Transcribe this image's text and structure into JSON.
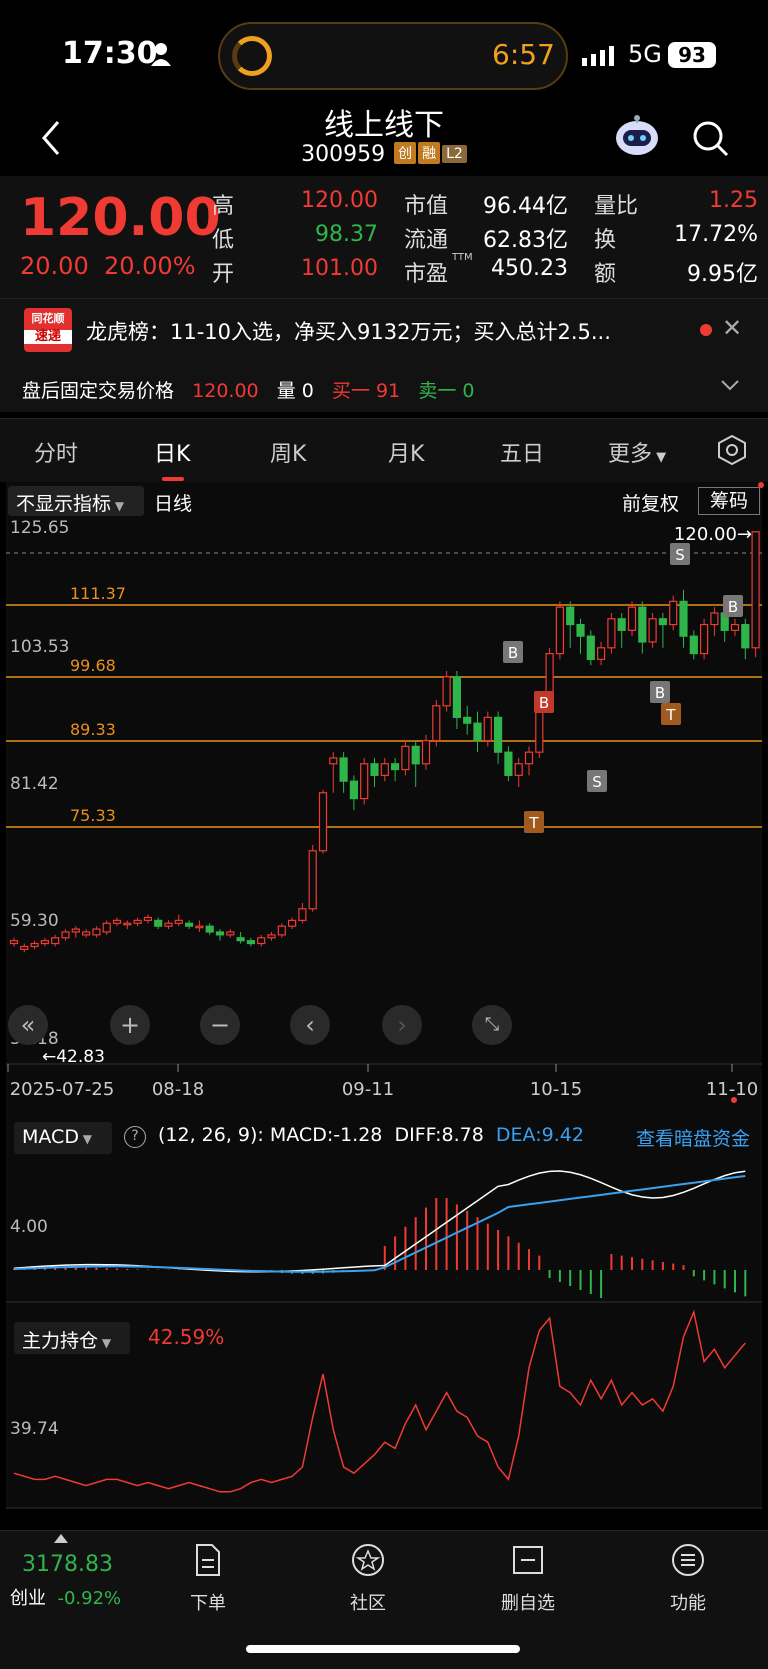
{
  "status_bar": {
    "time": "17:30",
    "island_time": "6:57",
    "network": "5G",
    "battery": "93"
  },
  "header": {
    "title": "线上线下",
    "code": "300959",
    "tags": [
      "创",
      "融",
      "L2"
    ]
  },
  "quote": {
    "price": "120.00",
    "change": "20.00",
    "change_pct": "20.00%",
    "high_label": "高",
    "high": "120.00",
    "low_label": "低",
    "low": "98.37",
    "open_label": "开",
    "open": "101.00",
    "mcap_label": "市值",
    "mcap": "96.44亿",
    "float_label": "流通",
    "float_cap": "62.83亿",
    "pe_label": "市盈",
    "pe_sup": "TTM",
    "pe": "450.23",
    "vol_ratio_label": "量比",
    "vol_ratio": "1.25",
    "turnover_label": "换",
    "turnover": "17.72%",
    "amount_label": "额",
    "amount": "9.95亿"
  },
  "news": {
    "logo_top": "同花顺",
    "logo_bottom": "速递",
    "text": "龙虎榜：11-10入选，净买入9132万元；买入总计2.5..."
  },
  "after_hours": {
    "label": "盘后固定交易价格",
    "price": "120.00",
    "volume": "量 0",
    "buy1": "买一 91",
    "sell1": "卖一 0"
  },
  "tabs": [
    "分时",
    "日K",
    "周K",
    "月K",
    "五日",
    "更多"
  ],
  "active_tab": "日K",
  "kline": {
    "indicator_select": "不显示指标",
    "period": "日线",
    "fuquan": "前复权",
    "chouma": "筹码",
    "price_label": "120.00→",
    "low_label": "←42.83",
    "y_ticks": [
      "125.65",
      "103.53",
      "81.42",
      "59.30",
      "37.18"
    ],
    "levels": [
      "111.37",
      "99.68",
      "89.33",
      "75.33"
    ],
    "x_dates": [
      "2025-07-25",
      "08-18",
      "09-11",
      "10-15",
      "11-10"
    ],
    "markers": [
      "B",
      "B",
      "T",
      "S",
      "B",
      "T",
      "S",
      "B"
    ]
  },
  "macd": {
    "label": "MACD",
    "params": "(12, 26, 9):",
    "macd": "MACD:-1.28",
    "diff": "DIFF:8.78",
    "dea": "DEA:9.42",
    "tick": "4.00",
    "link": "查看暗盘资金"
  },
  "holding": {
    "label": "主力持仓",
    "value": "42.59%",
    "tick": "39.74"
  },
  "bottom_nav": {
    "index_value": "3178.83",
    "index_name": "创业",
    "index_change": "-0.92%",
    "items": [
      "下单",
      "社区",
      "删自选",
      "功能"
    ]
  },
  "colors": {
    "up": "#f03a34",
    "down": "#2fb54a",
    "level": "#e8901a",
    "dea": "#3aa0f0"
  }
}
